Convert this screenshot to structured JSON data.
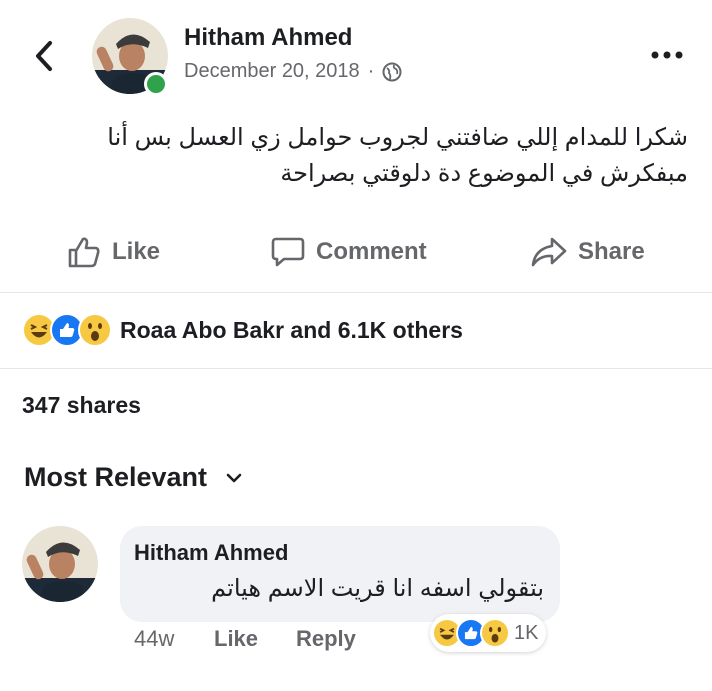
{
  "post": {
    "author": "Hitham Ahmed",
    "date": "December 20, 2018",
    "separator": "·",
    "audience_icon": "globe-icon",
    "text_line1": "شكرا للمدام إللي ضافتني لجروب حوامل زي العسل بس أنا",
    "text_line2": "مبفكرش في الموضوع دة دلوقتي بصراحة"
  },
  "actions": {
    "like": "Like",
    "comment": "Comment",
    "share": "Share"
  },
  "reactions": {
    "icons": [
      "laugh-emoji",
      "like-emoji",
      "wow-emoji"
    ],
    "summary": "Roaa Abo Bakr and 6.1K others"
  },
  "shares": "347 shares",
  "comments_sort": {
    "label": "Most Relevant"
  },
  "comment": {
    "author": "Hitham Ahmed",
    "text": "بتقولي اسفه انا قريت الاسم هياتم",
    "age": "44w",
    "like": "Like",
    "reply": "Reply",
    "reaction_count": "1K"
  },
  "colors": {
    "text": "#1c1e21",
    "muted": "#65676b",
    "online": "#31a24c",
    "like_blue": "#1877f2",
    "emoji_yellow": "#f7c943"
  }
}
